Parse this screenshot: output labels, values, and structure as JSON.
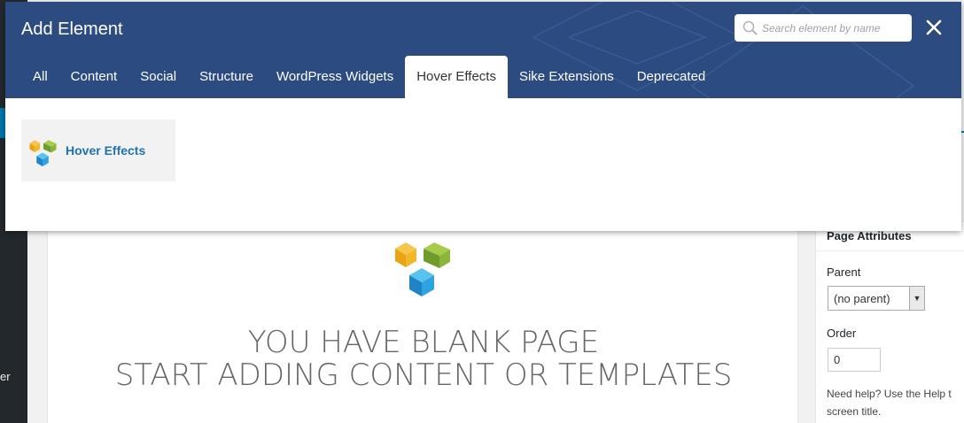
{
  "modal": {
    "title": "Add Element",
    "search_placeholder": "Search element by name",
    "tabs": [
      {
        "label": "All",
        "active": false
      },
      {
        "label": "Content",
        "active": false
      },
      {
        "label": "Social",
        "active": false
      },
      {
        "label": "Structure",
        "active": false
      },
      {
        "label": "WordPress Widgets",
        "active": false
      },
      {
        "label": "Hover Effects",
        "active": true
      },
      {
        "label": "Sike Extensions",
        "active": false
      },
      {
        "label": "Deprecated",
        "active": false
      }
    ],
    "elements": [
      {
        "label": "Hover Effects",
        "icon": "visual-composer-logo-icon"
      }
    ],
    "colors": {
      "header": "#2c4c81",
      "element_label": "#1e72b2"
    }
  },
  "editor": {
    "blank_line_1": "YOU HAVE BLANK PAGE",
    "blank_line_2": "START ADDING CONTENT OR TEMPLATES"
  },
  "page_attributes": {
    "title": "Page Attributes",
    "parent_label": "Parent",
    "parent_value": "(no parent)",
    "order_label": "Order",
    "order_value": "0",
    "help_line_1": "Need help? Use the Help t",
    "help_line_2": "screen title."
  },
  "wp_sidebar": {
    "menu_fragment": "er"
  }
}
